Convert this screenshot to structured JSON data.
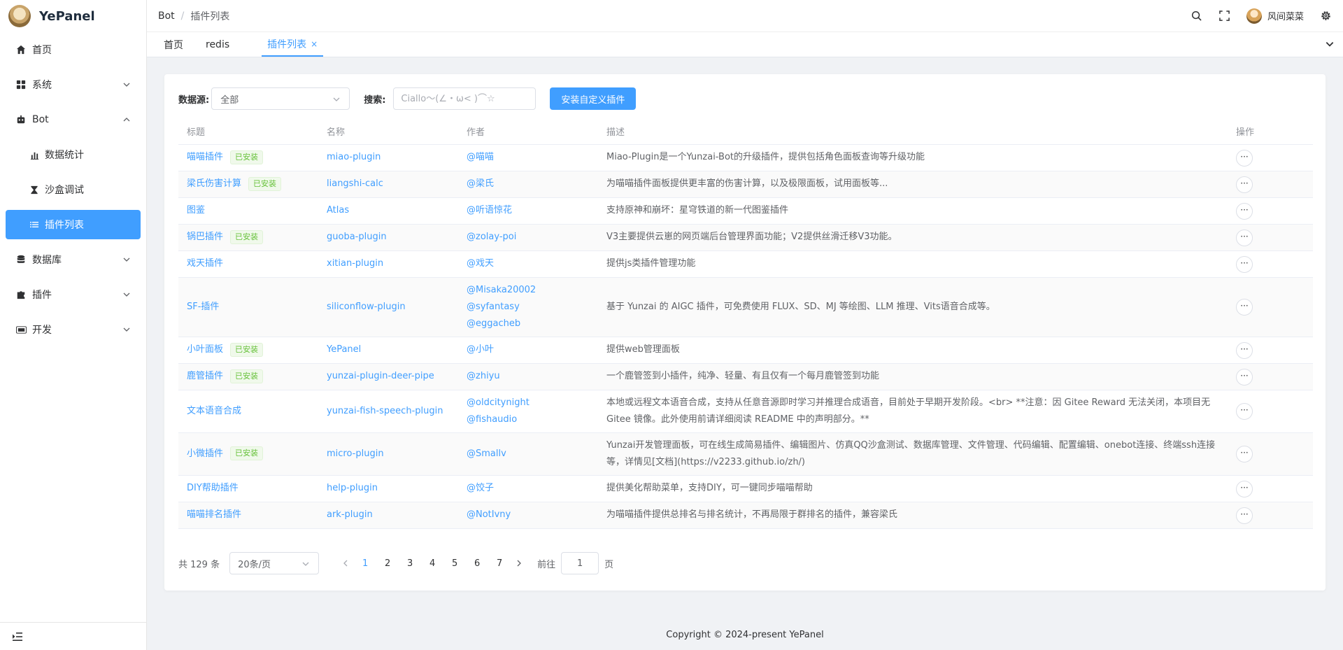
{
  "app": {
    "name": "YePanel"
  },
  "sidebar": {
    "items": [
      {
        "label": "首页"
      },
      {
        "label": "系统"
      },
      {
        "label": "Bot"
      },
      {
        "label": "数据统计"
      },
      {
        "label": "沙盒调试"
      },
      {
        "label": "插件列表"
      },
      {
        "label": "数据库"
      },
      {
        "label": "插件"
      },
      {
        "label": "开发"
      }
    ]
  },
  "header": {
    "breadcrumb": [
      "Bot",
      "/",
      "插件列表"
    ],
    "user_name": "风间菜菜"
  },
  "tabs": [
    {
      "label": "首页"
    },
    {
      "label": "redis"
    },
    {
      "label": "插件列表",
      "close": "×"
    }
  ],
  "filters": {
    "source_label": "数据源:",
    "source_value": "全部",
    "search_label": "搜索:",
    "search_placeholder": "Ciallo～(∠・ω< )⌒☆",
    "install_button": "安装自定义插件"
  },
  "table": {
    "columns": [
      "标题",
      "名称",
      "作者",
      "描述",
      "操作"
    ],
    "installed_badge": "已安装",
    "more_glyph": "···",
    "rows": [
      {
        "title": "喵喵插件",
        "installed": true,
        "name": "miao-plugin",
        "authors": [
          "@喵喵"
        ],
        "desc": "Miao-Plugin是一个Yunzai-Bot的升级插件，提供包括角色面板查询等升级功能"
      },
      {
        "title": "梁氏伤害计算",
        "installed": true,
        "name": "liangshi-calc",
        "authors": [
          "@梁氏"
        ],
        "desc": "为喵喵插件面板提供更丰富的伤害计算，以及极限面板，试用面板等..."
      },
      {
        "title": "图鉴",
        "installed": false,
        "name": "Atlas",
        "authors": [
          "@听语惊花"
        ],
        "desc": "支持原神和崩坏：星穹铁道的新一代图鉴插件"
      },
      {
        "title": "锅巴插件",
        "installed": true,
        "name": "guoba-plugin",
        "authors": [
          "@zolay-poi"
        ],
        "desc": "V3主要提供云崽的网页端后台管理界面功能；V2提供丝滑迁移V3功能。"
      },
      {
        "title": "戏天插件",
        "installed": false,
        "name": "xitian-plugin",
        "authors": [
          "@戏天"
        ],
        "desc": "提供js类插件管理功能"
      },
      {
        "title": "SF-插件",
        "installed": false,
        "name": "siliconflow-plugin",
        "authors": [
          "@Misaka20002",
          "@syfantasy",
          "@eggacheb"
        ],
        "desc": "基于 Yunzai 的 AIGC 插件，可免费使用 FLUX、SD、MJ 等绘图、LLM 推理、Vits语音合成等。"
      },
      {
        "title": "小叶面板",
        "installed": true,
        "name": "YePanel",
        "authors": [
          "@小叶"
        ],
        "desc": "提供web管理面板"
      },
      {
        "title": "鹿管插件",
        "installed": true,
        "name": "yunzai-plugin-deer-pipe",
        "authors": [
          "@zhiyu"
        ],
        "desc": "一个鹿管签到小插件，纯净、轻量、有且仅有一个每月鹿管签到功能"
      },
      {
        "title": "文本语音合成",
        "installed": false,
        "name": "yunzai-fish-speech-plugin",
        "authors": [
          "@oldcitynight",
          "@fishaudio"
        ],
        "desc": "本地或远程文本语音合成，支持从任意音源即时学习并推理合成语音，目前处于早期开发阶段。<br> **注意：因 Gitee Reward 无法关闭，本项目无 Gitee 镜像。此外使用前请详细阅读 README 中的声明部分。**"
      },
      {
        "title": "小微插件",
        "installed": true,
        "name": "micro-plugin",
        "authors": [
          "@Smallv"
        ],
        "desc": "Yunzai开发管理面板，可在线生成简易插件、编辑图片、仿真QQ沙盒测试、数据库管理、文件管理、代码编辑、配置编辑、onebot连接、终端ssh连接等，详情见[文档](https://v2233.github.io/zh/)"
      },
      {
        "title": "DIY帮助插件",
        "installed": false,
        "name": "help-plugin",
        "authors": [
          "@饺子"
        ],
        "desc": "提供美化帮助菜单，支持DIY，可一键同步喵喵帮助"
      },
      {
        "title": "喵喵排名插件",
        "installed": false,
        "name": "ark-plugin",
        "authors": [
          "@NotIvny"
        ],
        "desc": "为喵喵插件提供总排名与排名统计，不再局限于群排名的插件，兼容梁氏"
      }
    ]
  },
  "pagination": {
    "total": "共 129 条",
    "page_size": "20条/页",
    "pages": [
      "1",
      "2",
      "3",
      "4",
      "5",
      "6",
      "7"
    ],
    "current": "1",
    "goto_label": "前往",
    "goto_value": "1",
    "goto_suffix": "页"
  },
  "footer": {
    "copyright": "Copyright © 2024-present YePanel"
  },
  "colors": {
    "primary": "#409eff",
    "success": "#67c23a"
  }
}
